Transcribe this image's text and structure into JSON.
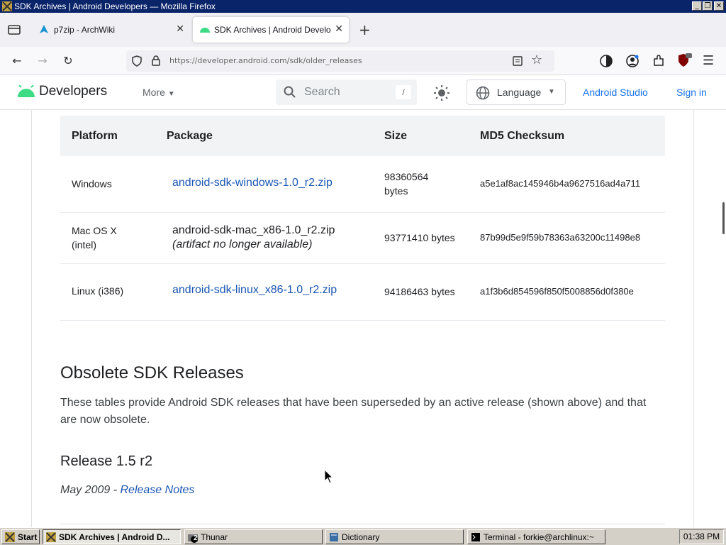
{
  "window": {
    "title": "SDK Archives  |  Android Developers — Mozilla Firefox",
    "controls": [
      "_",
      "❐",
      "✕"
    ]
  },
  "tabs": [
    {
      "label": "p7zip - ArchWiki",
      "active": false
    },
    {
      "label": "SDK Archives  |  Android Develope",
      "active": true
    }
  ],
  "nav": {
    "url": "https://developer.android.com/sdk/older_releases"
  },
  "site": {
    "brand": "Developers",
    "more": "More",
    "search_placeholder": "Search",
    "search_shortcut": "/",
    "language": "Language",
    "android_studio": "Android Studio",
    "sign_in": "Sign in"
  },
  "sdk_table": {
    "headers": [
      "Platform",
      "Package",
      "Size",
      "MD5 Checksum"
    ],
    "rows": [
      {
        "platform": "Windows",
        "package": "android-sdk-windows-1.0_r2.zip",
        "package_link": true,
        "size": "98360564 bytes",
        "md5": "a5e1af8ac145946b4a9627516ad4a711"
      },
      {
        "platform": "Mac OS X (intel)",
        "package": "android-sdk-mac_x86-1.0_r2.zip",
        "package_note": "(artifact no longer available)",
        "package_link": false,
        "size": "93771410 bytes",
        "md5": "87b99d5e9f59b78363a63200c11498e8"
      },
      {
        "platform": "Linux (i386)",
        "package": "android-sdk-linux_x86-1.0_r2.zip",
        "package_link": true,
        "size": "94186463 bytes",
        "md5": "a1f3b6d854596f850f5008856d0f380e"
      }
    ]
  },
  "obsolete": {
    "heading": "Obsolete SDK Releases",
    "paragraph": "These tables provide Android SDK releases that have been superseded by an active release (shown above) and that are now obsolete."
  },
  "release": {
    "heading": "Release 1.5 r2",
    "date": "May 2009 - ",
    "notes_link": "Release Notes"
  },
  "taskbar": {
    "start": "Start",
    "items": [
      {
        "label": "SDK Archives  |  Android D...",
        "active": true
      },
      {
        "label": "Thunar",
        "badge": "2"
      },
      {
        "label": "Dictionary"
      },
      {
        "label": "Terminal - forkie@archlinux:~"
      }
    ],
    "clock": "01:38 PM"
  },
  "colors": {
    "link": "#1a57b3",
    "android_green": "#3ddc84",
    "titlebar": "#0a246a"
  }
}
